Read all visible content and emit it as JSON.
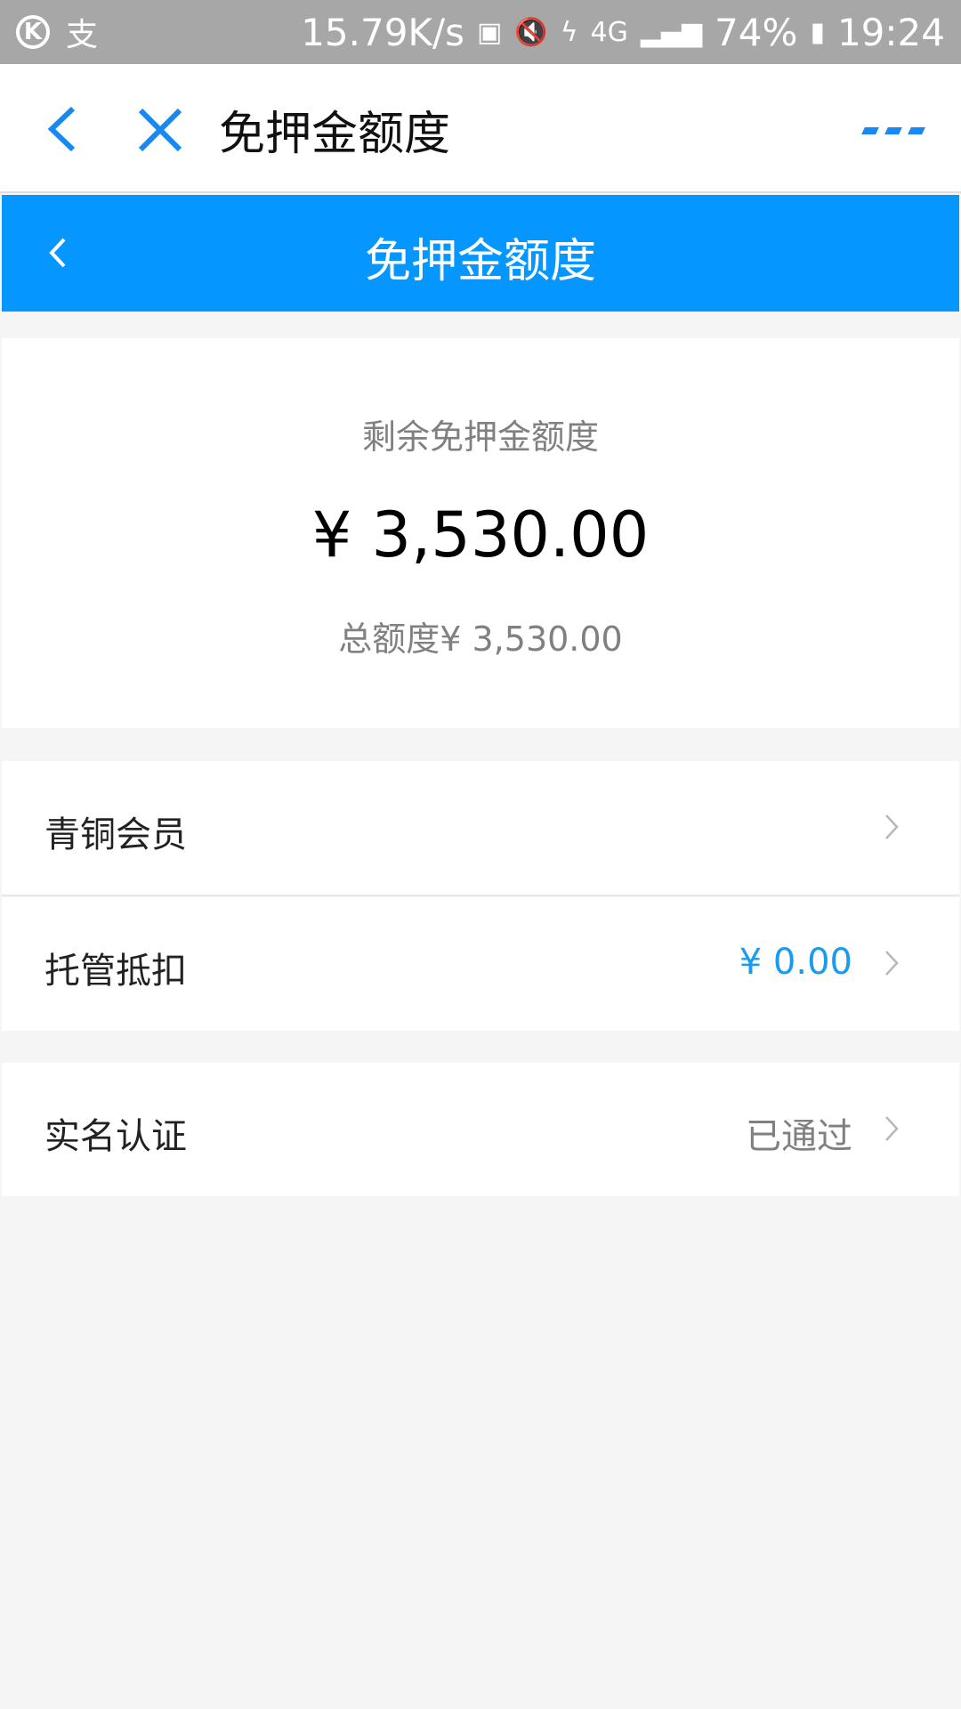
{
  "status_bar": {
    "k_icon": "K",
    "alipay_icon": "支",
    "network_speed": "15.79K/s",
    "signal_4g": "4G",
    "battery": "74%",
    "time": "19:24"
  },
  "header": {
    "title": "免押金额度"
  },
  "inner_bar": {
    "title": "免押金额度"
  },
  "quota": {
    "label": "剩余免押金额度",
    "amount": "¥ 3,530.00",
    "total": "总额度¥ 3,530.00"
  },
  "rows": [
    {
      "label": "青铜会员",
      "value": ""
    },
    {
      "label": "托管抵扣",
      "value": "¥ 0.00"
    },
    {
      "label": "实名认证",
      "value": "已通过"
    }
  ],
  "colors": {
    "accent": "#0597ff",
    "link_value": "#1a9bef",
    "muted": "#808080"
  }
}
